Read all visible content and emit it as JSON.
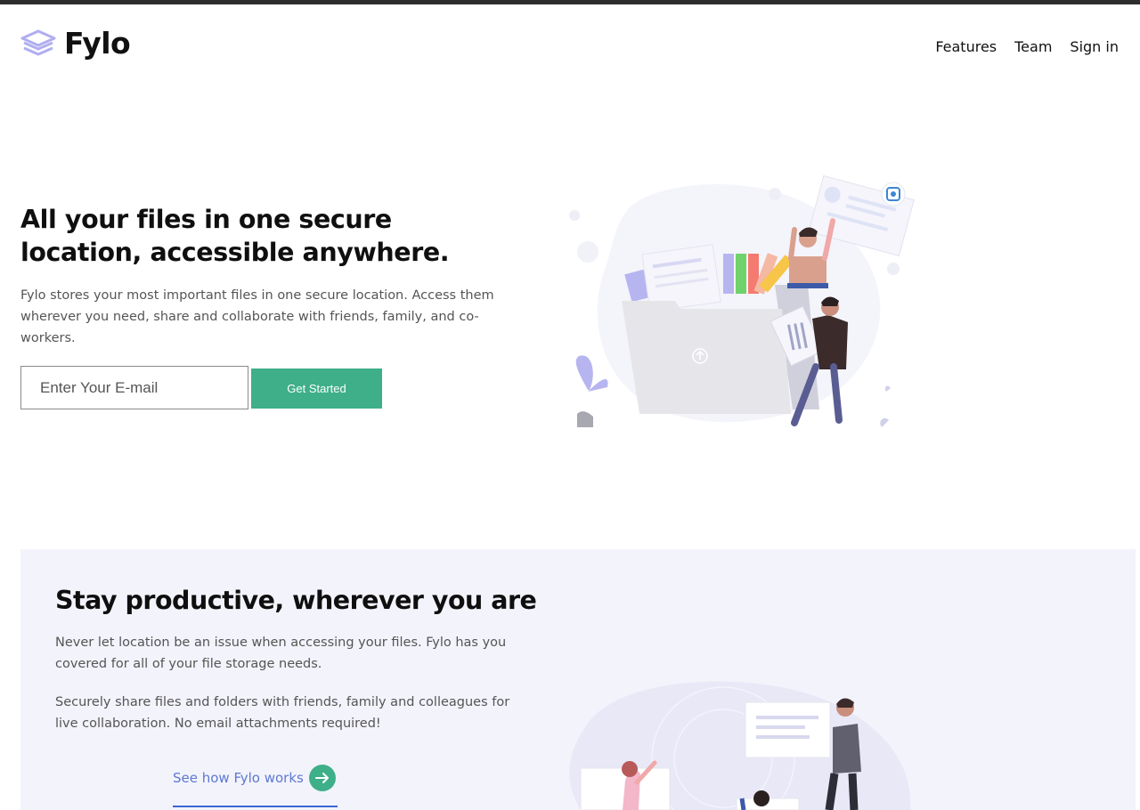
{
  "brand": {
    "name": "Fylo",
    "accent": "#3eaf88",
    "link_color": "#5d79d1",
    "section_bg": "#f3f3fc"
  },
  "nav": {
    "items": [
      "Features",
      "Team",
      "Sign in"
    ]
  },
  "hero": {
    "title": "All your files in one secure location, accessible anywhere.",
    "text": "Fylo stores your most important files in one secure location. Access them wherever you need, share and collaborate with friends, family, and co-workers.",
    "email_placeholder": "Enter Your E-mail",
    "cta_label": "Get Started"
  },
  "productive": {
    "title": "Stay productive, wherever you are",
    "p1": "Never let location be an issue when accessing your files. Fylo has you covered for all of your file storage needs.",
    "p2": "Securely share files and folders with friends, family and colleagues for live collaboration. No email attachments required!",
    "link_label": "See how Fylo works",
    "link_icon": "arrow-right-icon"
  }
}
